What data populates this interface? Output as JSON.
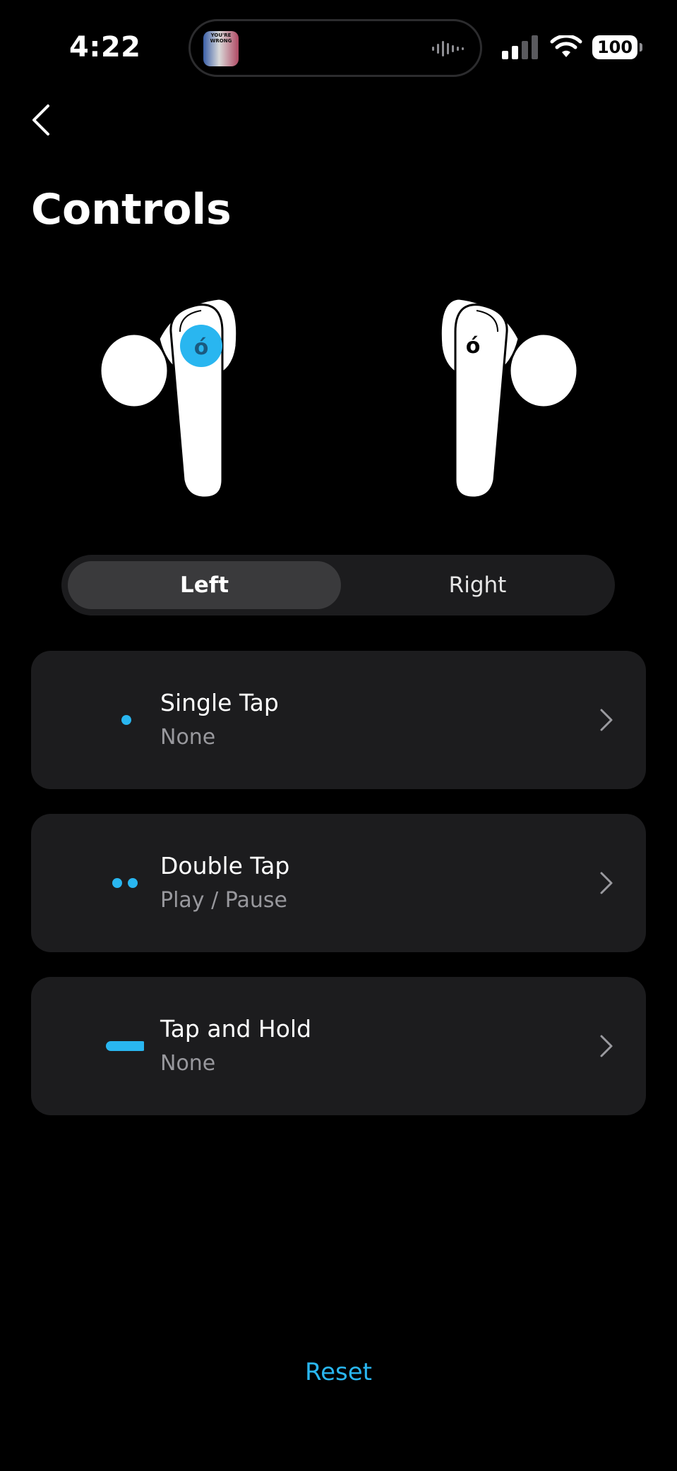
{
  "status_bar": {
    "time": "4:22",
    "battery": "100",
    "now_playing_art_text": "YOU'RE WRONG"
  },
  "header": {
    "back_icon": "chevron-left-icon",
    "title": "Controls"
  },
  "earbuds": {
    "selected": "left",
    "highlight_color": "#29b6f0"
  },
  "segmented": {
    "left_label": "Left",
    "right_label": "Right",
    "selected": "Left"
  },
  "controls": [
    {
      "icon": "single-dot-icon",
      "title": "Single Tap",
      "value": "None"
    },
    {
      "icon": "double-dot-icon",
      "title": "Double Tap",
      "value": "Play / Pause"
    },
    {
      "icon": "dash-icon",
      "title": "Tap and Hold",
      "value": "None"
    }
  ],
  "footer": {
    "reset_label": "Reset"
  },
  "colors": {
    "accent": "#29b6f0",
    "card_bg": "#1c1c1e",
    "background": "#000000",
    "secondary_text": "#98989d"
  }
}
